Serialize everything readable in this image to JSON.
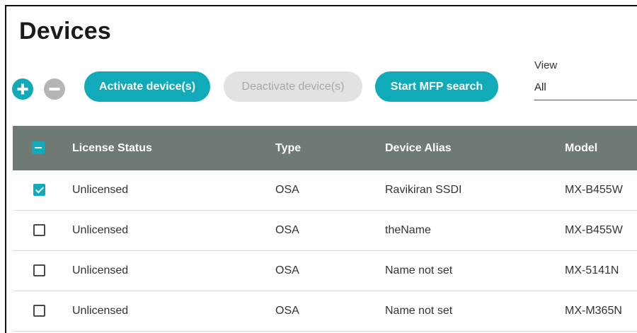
{
  "page": {
    "title": "Devices"
  },
  "toolbar": {
    "add_icon": "plus-circle-icon",
    "remove_icon": "minus-circle-icon",
    "activate_label": "Activate device(s)",
    "deactivate_label": "Deactivate device(s)",
    "deactivate_enabled": false,
    "mfp_search_label": "Start MFP search"
  },
  "view": {
    "label": "View",
    "selected": "All"
  },
  "table": {
    "select_all_state": "indeterminate",
    "columns": [
      "License Status",
      "Type",
      "Device Alias",
      "Model"
    ],
    "rows": [
      {
        "checked": true,
        "status": "Unlicensed",
        "type": "OSA",
        "alias": "Ravikiran SSDI",
        "model": "MX-B455W"
      },
      {
        "checked": false,
        "status": "Unlicensed",
        "type": "OSA",
        "alias": "theName",
        "model": "MX-B455W"
      },
      {
        "checked": false,
        "status": "Unlicensed",
        "type": "OSA",
        "alias": "Name not set",
        "model": "MX-5141N"
      },
      {
        "checked": false,
        "status": "Unlicensed",
        "type": "OSA",
        "alias": "Name not set",
        "model": "MX-M365N"
      }
    ]
  },
  "colors": {
    "accent": "#10aab8",
    "header_bg": "#6e7a72",
    "disabled_bg": "#e2e2e2",
    "disabled_icon": "#b5b5b5"
  }
}
